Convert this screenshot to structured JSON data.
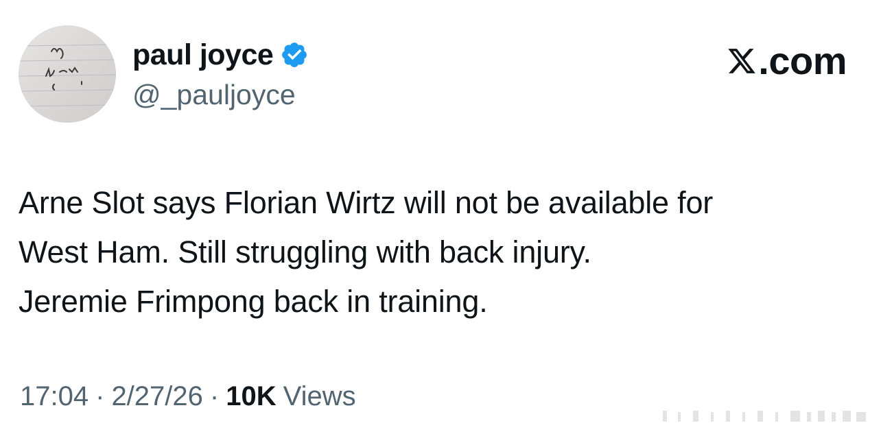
{
  "author": {
    "display_name": "paul joyce",
    "handle": "@_pauljoyce",
    "verified": true,
    "avatar_icon": "handwriting-note-avatar"
  },
  "brand": {
    "label": ".com",
    "logo_icon": "x-logo-icon"
  },
  "tweet": {
    "lines": [
      "Arne Slot says Florian Wirtz will not be available for",
      "West Ham. Still struggling with back injury.",
      "Jeremie Frimpong back in training."
    ]
  },
  "meta": {
    "time": "17:04",
    "date": "2/27/26",
    "separator": "·",
    "views_count": "10K",
    "views_label": "Views"
  },
  "colors": {
    "text_primary": "#0f1419",
    "text_secondary": "#536471",
    "verified_blue": "#1d9bf0"
  }
}
